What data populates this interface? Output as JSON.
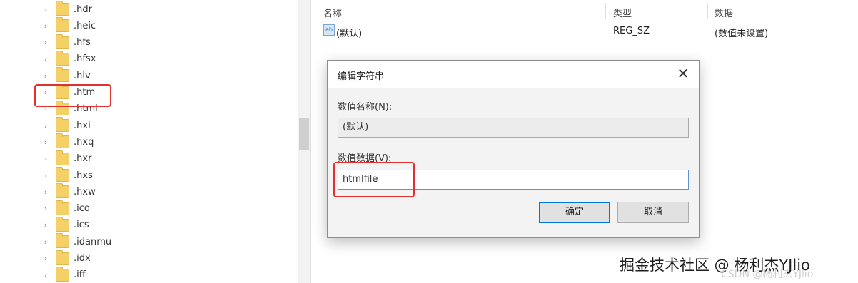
{
  "tree": {
    "items": [
      {
        "label": ".hdr"
      },
      {
        "label": ".heic"
      },
      {
        "label": ".hfs"
      },
      {
        "label": ".hfsx"
      },
      {
        "label": ".hlv"
      },
      {
        "label": ".htm",
        "highlighted": true
      },
      {
        "label": ".html"
      },
      {
        "label": ".hxi"
      },
      {
        "label": ".hxq"
      },
      {
        "label": ".hxr"
      },
      {
        "label": ".hxs"
      },
      {
        "label": ".hxw"
      },
      {
        "label": ".ico"
      },
      {
        "label": ".ics"
      },
      {
        "label": ".idanmu"
      },
      {
        "label": ".idx"
      },
      {
        "label": ".iff"
      }
    ],
    "chevron": "chevron-right-icon",
    "folder_icon": "folder-icon",
    "folder_color": "#f5d067"
  },
  "list": {
    "headers": {
      "name": "名称",
      "type": "类型",
      "data": "数据"
    },
    "rows": [
      {
        "icon": "ab",
        "name": "(默认)",
        "type": "REG_SZ",
        "data": "(数值未设置)"
      }
    ]
  },
  "dialog": {
    "title": "编辑字符串",
    "close_glyph": "✕",
    "name_label": "数值名称(N):",
    "name_value": "(默认)",
    "data_label": "数值数据(V):",
    "data_value": "htmlfile",
    "ok": "确定",
    "cancel": "取消"
  },
  "highlight_color": "#e03030",
  "watermark": {
    "text": "掘金技术社区 @ 杨利杰YJlio",
    "faint": "CSDN @杨利杰YJlio"
  }
}
